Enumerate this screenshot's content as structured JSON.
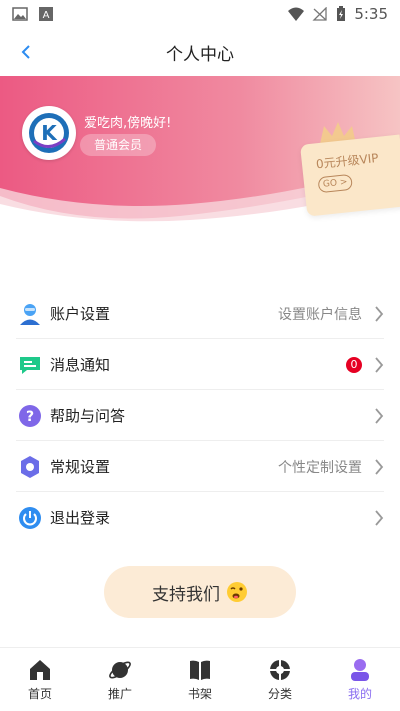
{
  "status_bar": {
    "time": "5:35"
  },
  "header": {
    "title": "个人中心"
  },
  "profile": {
    "greeting": "爱吃肉,傍晚好!",
    "member_level": "普通会员",
    "avatar_letter": "K"
  },
  "vip_card": {
    "text": "0元升级VIP",
    "go_label": "GO >"
  },
  "menu": {
    "items": [
      {
        "label": "账户设置",
        "hint": "设置账户信息",
        "icon": "account-icon"
      },
      {
        "label": "消息通知",
        "badge": "0",
        "icon": "message-icon"
      },
      {
        "label": "帮助与问答",
        "icon": "help-icon"
      },
      {
        "label": "常规设置",
        "hint": "个性定制设置",
        "icon": "settings-icon"
      },
      {
        "label": "退出登录",
        "icon": "logout-icon"
      }
    ]
  },
  "support": {
    "label": "支持我们"
  },
  "bottom_nav": {
    "items": [
      {
        "label": "首页",
        "icon": "home-icon"
      },
      {
        "label": "推广",
        "icon": "planet-icon"
      },
      {
        "label": "书架",
        "icon": "book-icon"
      },
      {
        "label": "分类",
        "icon": "category-icon"
      },
      {
        "label": "我的",
        "icon": "profile-icon",
        "active": true
      }
    ]
  },
  "colors": {
    "banner_start": "#ec5a83",
    "banner_end": "#f6c4c4",
    "accent": "#8a6df0",
    "badge": "#e60023",
    "support_bg": "#fcebd6"
  }
}
